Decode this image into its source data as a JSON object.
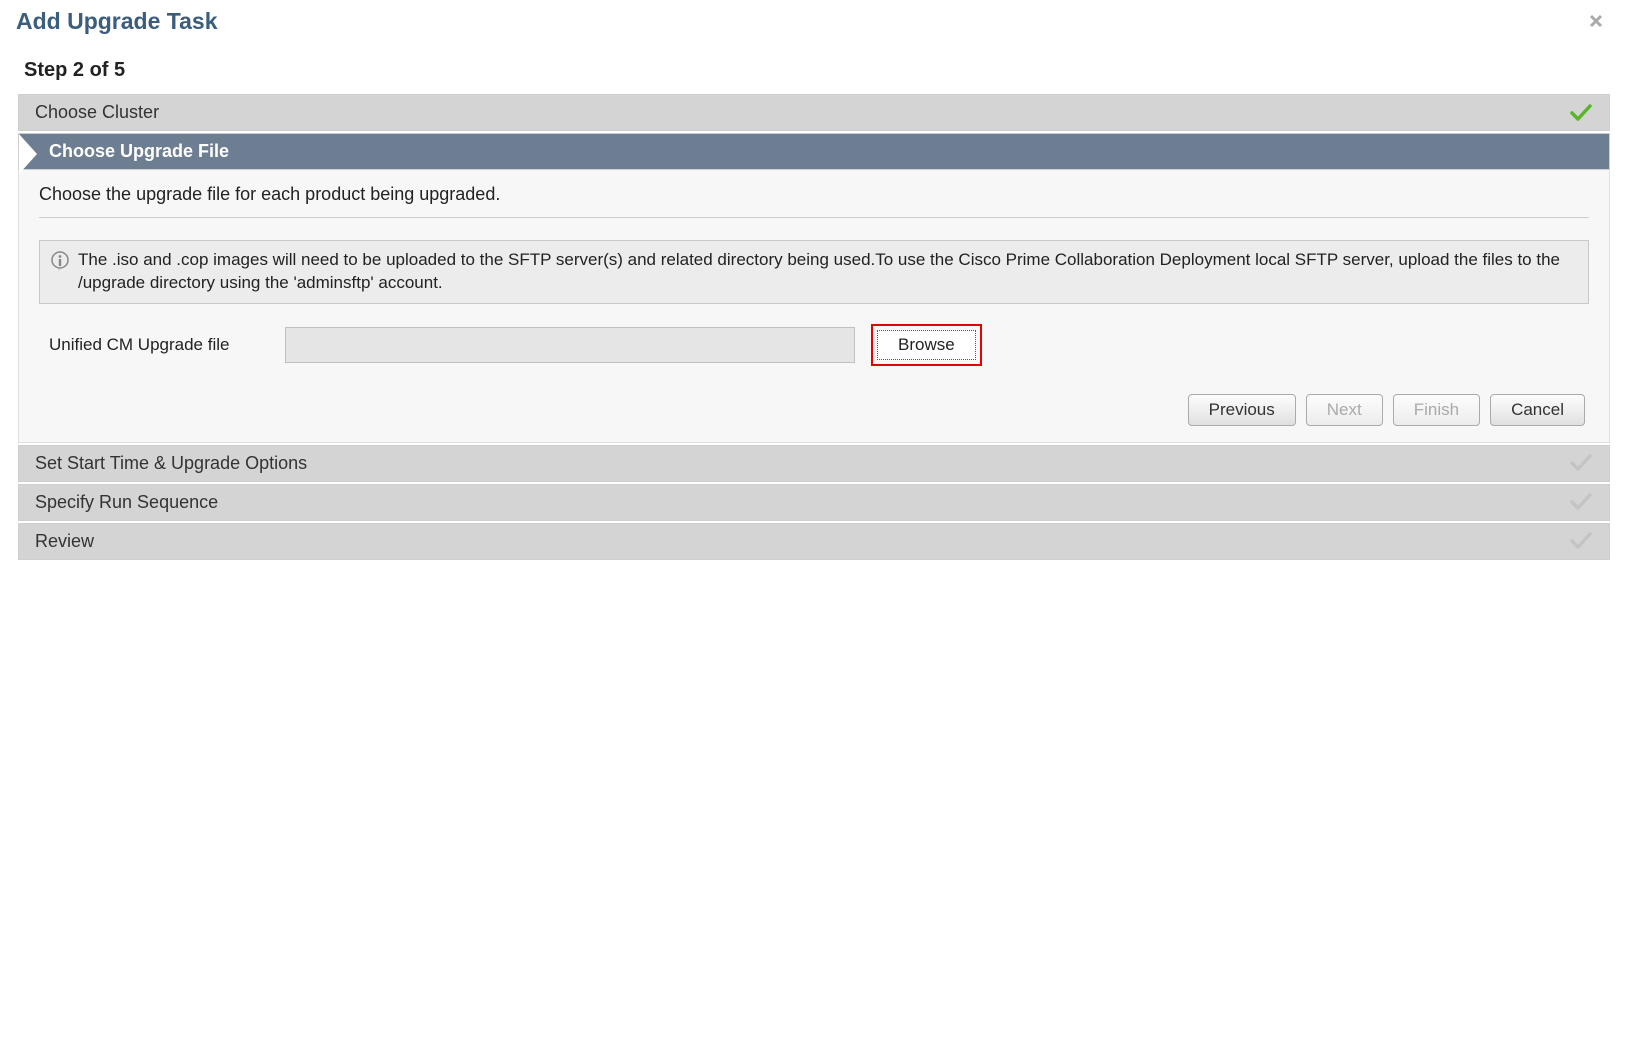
{
  "dialog": {
    "title": "Add Upgrade Task",
    "step_indicator": "Step 2 of 5"
  },
  "steps": {
    "choose_cluster": "Choose Cluster",
    "choose_upgrade_file": "Choose Upgrade File",
    "set_start_time": "Set Start Time & Upgrade Options",
    "specify_run_sequence": "Specify Run Sequence",
    "review": "Review"
  },
  "content": {
    "description": "Choose the upgrade file for each product being upgraded.",
    "info_text": "The .iso and .cop images will need to be uploaded to the SFTP server(s) and related directory being used.To use the Cisco Prime Collaboration Deployment local SFTP server, upload the files to the /upgrade directory using the 'adminsftp' account.",
    "file_label": "Unified CM Upgrade file",
    "file_value": "",
    "browse_label": "Browse"
  },
  "buttons": {
    "previous": "Previous",
    "next": "Next",
    "finish": "Finish",
    "cancel": "Cancel"
  }
}
